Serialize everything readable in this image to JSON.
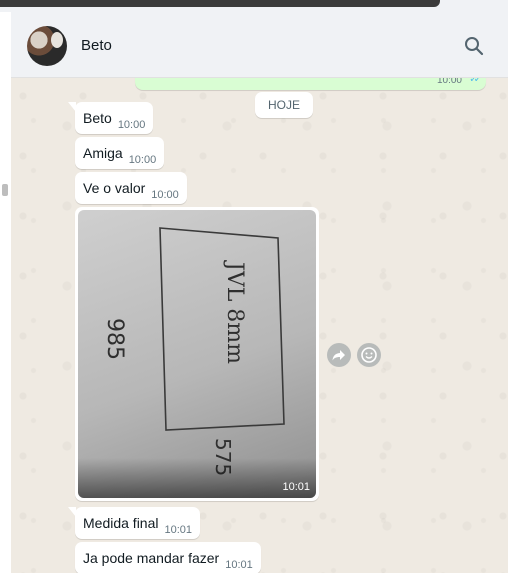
{
  "header": {
    "contact_name": "Beto",
    "avatar_icon": "profile-photo",
    "search_icon": "search-icon"
  },
  "chat": {
    "date_divider": "HOJE",
    "previous_outgoing": {
      "time": "10:00",
      "status_icon": "double-check-icon",
      "status_color": "#53bdeb"
    },
    "messages": [
      {
        "text": "Beto",
        "time": "10:00"
      },
      {
        "text": "Amiga",
        "time": "10:00"
      },
      {
        "text": "Ve o valor",
        "time": "10:00"
      }
    ],
    "image_message": {
      "time": "10:01",
      "handwriting": [
        "985",
        "JVL 8mm",
        "575"
      ],
      "actions": [
        "forward-icon",
        "emoji-icon"
      ]
    },
    "messages_after": [
      {
        "text": "Medida final",
        "time": "10:01"
      },
      {
        "text": "Ja pode mandar fazer",
        "time": "10:01"
      }
    ]
  },
  "colors": {
    "header_bg": "#f0f2f5",
    "chat_bg": "#efeae2",
    "incoming_bubble": "#ffffff",
    "outgoing_bubble": "#d9fdd3"
  }
}
